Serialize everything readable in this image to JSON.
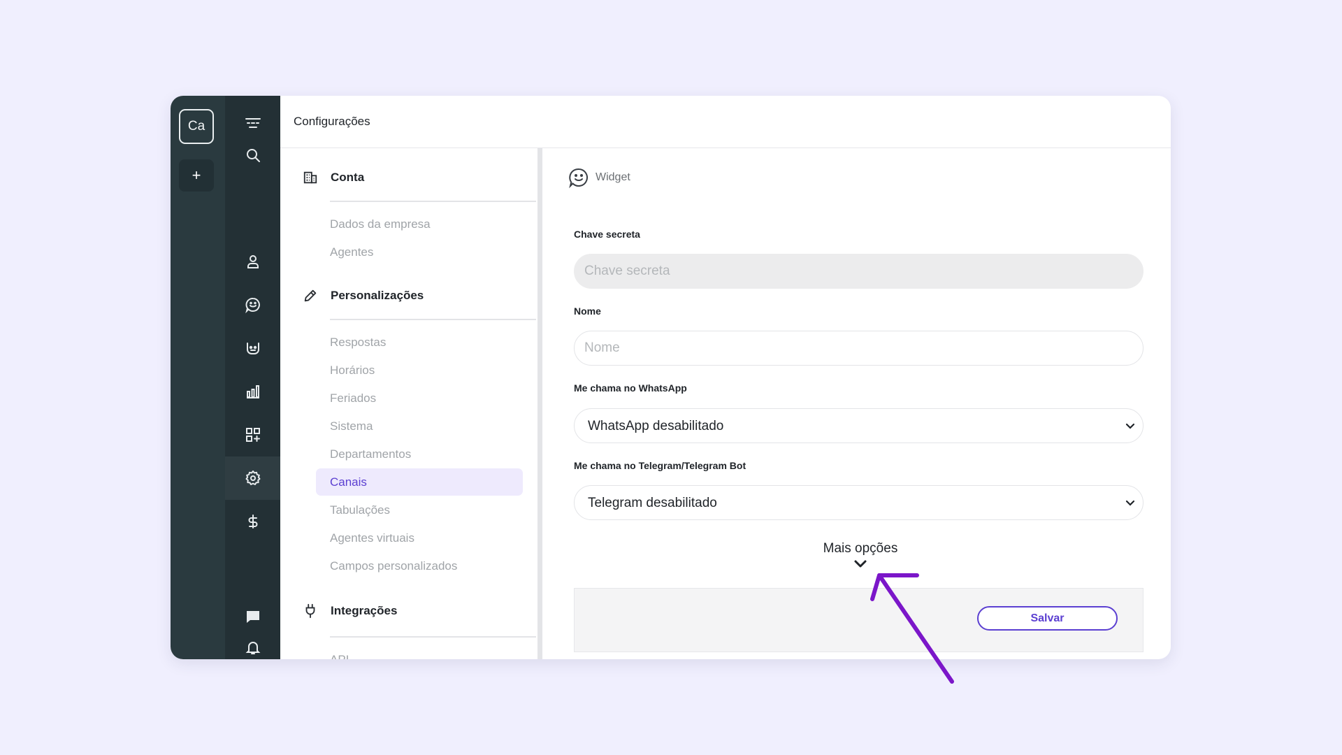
{
  "workspace": {
    "badge": "Ca",
    "add_label": "+"
  },
  "header": {
    "title": "Configurações"
  },
  "rail_icons": [
    "menu-icon",
    "search-icon",
    "user-icon",
    "chat-icon",
    "bot-icon",
    "chart-icon",
    "apps-icon",
    "gear-icon",
    "dollar-icon",
    "message-icon",
    "bell-icon"
  ],
  "menu": {
    "sections": [
      {
        "icon": "building-icon",
        "label": "Conta",
        "items": [
          "Dados da empresa",
          "Agentes"
        ]
      },
      {
        "icon": "pencil-icon",
        "label": "Personalizações",
        "items": [
          "Respostas",
          "Horários",
          "Feriados",
          "Sistema",
          "Departamentos",
          "Canais",
          "Tabulações",
          "Agentes virtuais",
          "Campos personalizados"
        ]
      },
      {
        "icon": "plug-icon",
        "label": "Integrações",
        "items": [
          "API"
        ]
      }
    ],
    "active_item": "Canais"
  },
  "channel": {
    "icon": "widget-chat-icon",
    "name": "Widget"
  },
  "form": {
    "secret": {
      "label": "Chave secreta",
      "placeholder": "Chave secreta"
    },
    "name": {
      "label": "Nome",
      "placeholder": "Nome"
    },
    "whatsapp": {
      "label": "Me chama no WhatsApp",
      "value": "WhatsApp desabilitado"
    },
    "telegram": {
      "label": "Me chama no Telegram/Telegram Bot",
      "value": "Telegram desabilitado"
    },
    "more_options": "Mais opções",
    "save": "Salvar"
  },
  "colors": {
    "accent": "#5b3fd1",
    "sidebar_dark": "#233035",
    "sidebar_darker": "#2a3a3f",
    "annotation_arrow": "#7b16c9",
    "page_bg": "#f0effe"
  }
}
